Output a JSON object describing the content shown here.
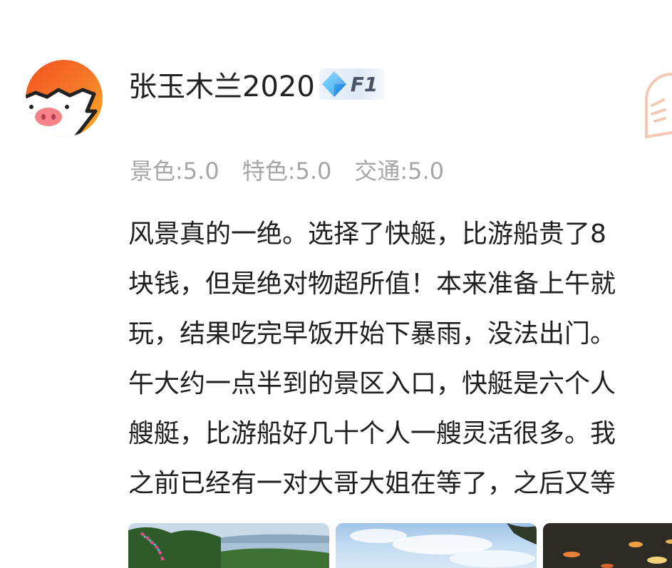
{
  "user": {
    "name": "张玉木兰2020",
    "level": "F1"
  },
  "ratings": [
    "景色:5.0",
    "特色:5.0",
    "交通:5.0"
  ],
  "review": {
    "lines": [
      "风景真的一绝。选择了快艇，比游船贵了8",
      "块钱，但是绝对物超所值！本来准备上午就",
      "玩，结果吃完早饭开始下暴雨，没法出门。",
      "午大约一点半到的景区入口，快艇是六个人",
      "艘艇，比游船好几十个人一艘灵活很多。我",
      "之前已经有一对大哥大姐在等了，之后又等"
    ]
  },
  "colors": {
    "avatar_orange": "#f57b2a",
    "avatar_yellow": "#ffb21d",
    "rating_gray": "#a6a6a6",
    "text": "#1f1f1f"
  }
}
